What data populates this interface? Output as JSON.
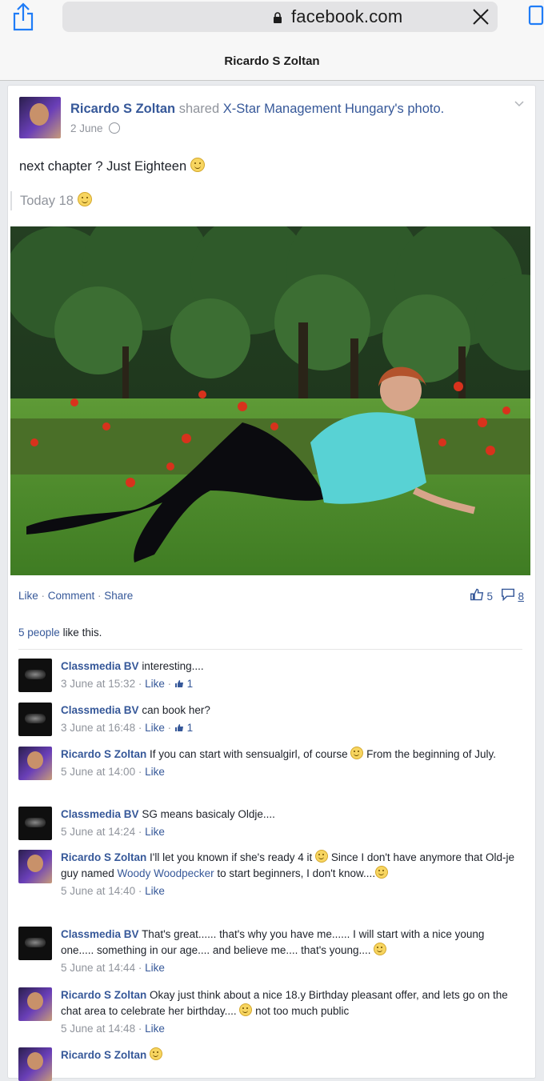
{
  "browser": {
    "url": "facebook.com",
    "page_title": "Ricardo S Zoltan"
  },
  "post": {
    "author": "Ricardo S Zoltan",
    "shared_word": "shared",
    "shared_from": "X-Star Management Hungary",
    "shared_suffix": "'s photo.",
    "date": "2 June",
    "text": "next chapter ? Just Eighteen",
    "quote": "Today 18",
    "actions": {
      "like": "Like",
      "comment": "Comment",
      "share": "Share",
      "sep": " · "
    },
    "like_count": "5",
    "comment_count": "8",
    "likes_summary_link": "5 people",
    "likes_summary_rest": " like this."
  },
  "comments": [
    {
      "name": "Classmedia BV",
      "text": "interesting....",
      "time": "3 June at 15:32",
      "like": "Like",
      "likes": "1",
      "avatar": "dark"
    },
    {
      "name": "Classmedia BV",
      "text": "can book her?",
      "time": "3 June at 16:48",
      "like": "Like",
      "likes": "1",
      "avatar": "dark"
    },
    {
      "name": "Ricardo S Zoltan",
      "text": "If you can start with sensualgirl, of course",
      "text2": " From the beginning of July.",
      "time": "5 June at 14:00",
      "like": "Like",
      "avatar": "person"
    },
    {
      "name": "Classmedia BV",
      "text": "SG means basicaly Oldje....",
      "time": "5 June at 14:24",
      "like": "Like",
      "avatar": "dark"
    },
    {
      "name": "Ricardo S Zoltan",
      "text": "I'll let you known if she's ready 4 it",
      "text2": " Since I don't have anymore that Old-je guy named ",
      "mention": "Woody Woodpecker",
      "text3": " to start beginners, I don't know....",
      "time": "5 June at 14:40",
      "like": "Like",
      "avatar": "person"
    },
    {
      "name": "Classmedia BV",
      "text": "That's great...... that's why you have me...... I will start with a nice young one..... something in our age.... and believe me.... that's young....",
      "time": "5 June at 14:44",
      "like": "Like",
      "avatar": "dark"
    },
    {
      "name": "Ricardo S Zoltan",
      "text": "Okay just think about a nice 18.y Birthday pleasant offer, and lets go on the chat area to celebrate her birthday....",
      "text2": " not too much public",
      "time": "5 June at 14:48",
      "like": "Like",
      "avatar": "person"
    },
    {
      "name": "Ricardo S Zoltan",
      "avatar": "person"
    }
  ],
  "colors": {
    "link": "#365899",
    "muted": "#90949c",
    "text": "#1d2129"
  },
  "icons": [
    "share-icon",
    "lock-icon",
    "close-icon",
    "tabs-icon",
    "globe-icon",
    "chevron-down-icon",
    "smiley-icon",
    "thumbs-up-icon",
    "comment-icon"
  ]
}
